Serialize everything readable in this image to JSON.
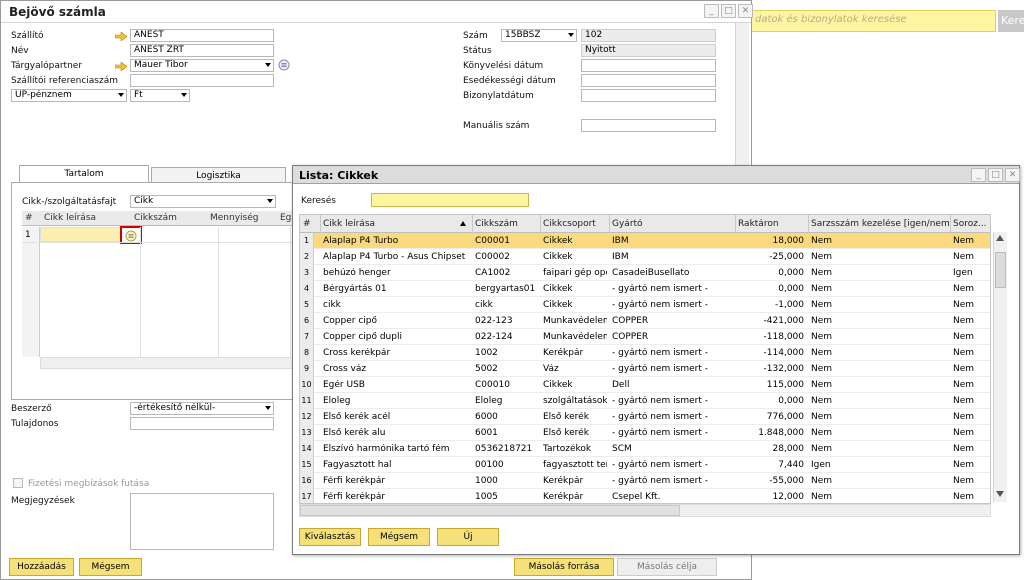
{
  "top_search": {
    "placeholder": "datok és bizonylatok keresése",
    "button": "Kere"
  },
  "main": {
    "title": "Bejövő számla",
    "fields_left": [
      {
        "label": "Szállító",
        "value": "ANEST",
        "arrow": true
      },
      {
        "label": "Név",
        "value": "ANEST ZRT",
        "arrow": false
      },
      {
        "label": "Tárgyalópartner",
        "value": "Mauer Tibor",
        "arrow": true
      },
      {
        "label": "Szállítói referenciaszám",
        "value": "",
        "arrow": false
      }
    ],
    "currency_label": "ÜP-pénznem",
    "currency_value": "Ft",
    "fields_right": [
      {
        "label": "Szám",
        "series": "15BBSZ",
        "value": "102"
      },
      {
        "label": "Státus",
        "value": "Nyitott"
      },
      {
        "label": "Könyvelési dátum",
        "value": ""
      },
      {
        "label": "Esedékességi dátum",
        "value": ""
      },
      {
        "label": "Bizonylatdátum",
        "value": ""
      }
    ],
    "manual_label": "Manuális szám",
    "tabs": [
      "Tartalom",
      "Logisztika"
    ],
    "item_type_label": "Cikk-/szolgáltatásfajt",
    "item_type_value": "Cikk",
    "grid_headers": [
      "#",
      "Cikk leírása",
      "Cikkszám",
      "Mennyiség",
      "Eg"
    ],
    "grid_row_num": "1",
    "buyer_label": "Beszerző",
    "buyer_value": "-értékesítő nélkül-",
    "owner_label": "Tulajdonos",
    "payment_check_label": "Fizetési megbízások futása",
    "remarks_label": "Megjegyzések",
    "buttons": {
      "add": "Hozzáadás",
      "cancel": "Mégsem",
      "copy_from": "Másolás forrása",
      "copy_to": "Másolás célja"
    }
  },
  "dialog": {
    "title": "Lista: Cikkek",
    "search_label": "Keresés",
    "columns": [
      "#",
      "Cikk leírása",
      "Cikkszám",
      "Cikkcsoport",
      "Gyártó",
      "Raktáron",
      "Sarzsszám kezelése [igen/nem]",
      "Soroz..."
    ],
    "rows": [
      [
        "1",
        "Alaplap P4 Turbo",
        "C00001",
        "Cikkek",
        "IBM",
        "18,000",
        "Nem",
        "Nem"
      ],
      [
        "2",
        "Alaplap P4 Turbo - Asus Chipset",
        "C00002",
        "Cikkek",
        "IBM",
        "-25,000",
        "Nem",
        "Nem"
      ],
      [
        "3",
        "behúzó henger",
        "CA1002",
        "faipari gép opci",
        "CasadeiBusellato",
        "0,000",
        "Nem",
        "Igen"
      ],
      [
        "4",
        "Bérgyártás 01",
        "bergyartas01",
        "Cikkek",
        "- gyártó nem ismert -",
        "0,000",
        "Nem",
        "Nem"
      ],
      [
        "5",
        "cikk",
        "cikk",
        "Cikkek",
        "- gyártó nem ismert -",
        "-1,000",
        "Nem",
        "Nem"
      ],
      [
        "6",
        "Copper cipő",
        "022-123",
        "Munkavédelem",
        "COPPER",
        "-421,000",
        "Nem",
        "Nem"
      ],
      [
        "7",
        "Copper cipő dupli",
        "022-124",
        "Munkavédelem",
        "COPPER",
        "-118,000",
        "Nem",
        "Nem"
      ],
      [
        "8",
        "Cross kerékpár",
        "1002",
        "Kerékpár",
        "- gyártó nem ismert -",
        "-114,000",
        "Nem",
        "Nem"
      ],
      [
        "9",
        "Cross váz",
        "5002",
        "Váz",
        "- gyártó nem ismert -",
        "-132,000",
        "Nem",
        "Nem"
      ],
      [
        "10",
        "Egér USB",
        "C00010",
        "Cikkek",
        "Dell",
        "115,000",
        "Nem",
        "Nem"
      ],
      [
        "11",
        "Eloleg",
        "Eloleg",
        "szolgáltatások",
        "- gyártó nem ismert -",
        "0,000",
        "Nem",
        "Nem"
      ],
      [
        "12",
        "Első kerék acél",
        "6000",
        "Első kerék",
        "- gyártó nem ismert -",
        "776,000",
        "Nem",
        "Nem"
      ],
      [
        "13",
        "Első kerék alu",
        "6001",
        "Első kerék",
        "- gyártó nem ismert -",
        "1.848,000",
        "Nem",
        "Nem"
      ],
      [
        "14",
        "Elszívó harmónika tartó fém",
        "0536218721",
        "Tartozékok",
        "SCM",
        "28,000",
        "Nem",
        "Nem"
      ],
      [
        "15",
        "Fagyasztott hal",
        "00100",
        "fagyasztott teng",
        "- gyártó nem ismert -",
        "7,440",
        "Igen",
        "Nem"
      ],
      [
        "16",
        "Férfi kerékpár",
        "1000",
        "Kerékpár",
        "- gyártó nem ismert -",
        "-55,000",
        "Nem",
        "Nem"
      ],
      [
        "17",
        "Férfi kerékpár",
        "1005",
        "Kerékpár",
        "Csepel Kft.",
        "12,000",
        "Nem",
        "Nem"
      ]
    ],
    "buttons": {
      "select": "Kiválasztás",
      "cancel": "Mégsem",
      "new": "Új"
    }
  }
}
